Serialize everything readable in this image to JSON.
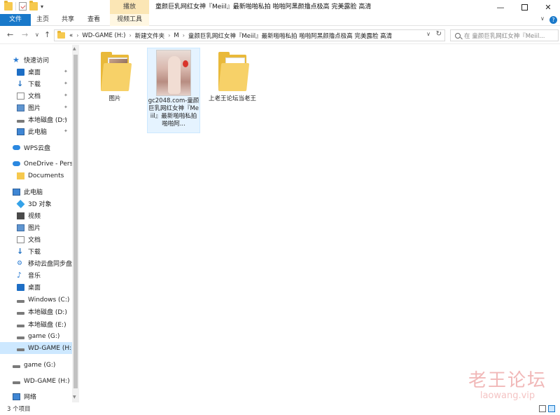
{
  "window": {
    "title": "童颜巨乳网红女神『Meiil』最新啪啪私拍 啪啪阿黑颜撸点极高 完美露脸 高清",
    "context_tab": "播放",
    "controls": {
      "minimize": "—",
      "close": "✕"
    }
  },
  "ribbon": {
    "tabs": [
      "文件",
      "主页",
      "共享",
      "查看",
      "视频工具"
    ],
    "help": "?",
    "toggle": "∨"
  },
  "address": {
    "overflow": "«",
    "breadcrumbs": [
      "WD-GAME (H:)",
      "新建文件夹",
      "M",
      "童颜巨乳网红女神『Meiil』最新啪啪私拍 啪啪阿黑颜撸点极高 完美露脸 高清"
    ],
    "separator": "›",
    "search_placeholder": "在 童颜巨乳网红女神『Meiil...",
    "nav": {
      "back": "←",
      "forward": "→",
      "recent": "∨",
      "up": "↑",
      "refresh": "↻",
      "dropdown": "∨"
    }
  },
  "sidebar": {
    "items": [
      {
        "label": "快速访问",
        "icon": "star-icon",
        "pinned": false
      },
      {
        "label": "桌面",
        "icon": "desktop-icon",
        "pinned": true
      },
      {
        "label": "下载",
        "icon": "download-icon",
        "pinned": true
      },
      {
        "label": "文档",
        "icon": "document-icon",
        "pinned": true
      },
      {
        "label": "图片",
        "icon": "pictures-icon",
        "pinned": true
      },
      {
        "label": "本地磁盘 (D:)",
        "icon": "drive-icon",
        "pinned": true
      },
      {
        "label": "此电脑",
        "icon": "computer-icon",
        "pinned": true
      },
      {
        "label": "WPS云盘",
        "icon": "cloud-icon",
        "pinned": false
      },
      {
        "label": "OneDrive - Perso",
        "icon": "onedrive-icon",
        "pinned": false
      },
      {
        "label": "Documents",
        "icon": "folder-icon",
        "pinned": false
      },
      {
        "label": "此电脑",
        "icon": "computer-icon",
        "pinned": false
      },
      {
        "label": "3D 对象",
        "icon": "3d-objects-icon",
        "pinned": false
      },
      {
        "label": "视频",
        "icon": "video-icon",
        "pinned": false
      },
      {
        "label": "图片",
        "icon": "pictures-icon",
        "pinned": false
      },
      {
        "label": "文档",
        "icon": "document-icon",
        "pinned": false
      },
      {
        "label": "下载",
        "icon": "download-icon",
        "pinned": false
      },
      {
        "label": "移动云盘同步盘",
        "icon": "sync-icon",
        "pinned": false
      },
      {
        "label": "音乐",
        "icon": "music-icon",
        "pinned": false
      },
      {
        "label": "桌面",
        "icon": "desktop-icon",
        "pinned": false
      },
      {
        "label": "Windows (C:)",
        "icon": "drive-icon",
        "pinned": false
      },
      {
        "label": "本地磁盘 (D:)",
        "icon": "drive-icon",
        "pinned": false
      },
      {
        "label": "本地磁盘 (E:)",
        "icon": "drive-icon",
        "pinned": false
      },
      {
        "label": "game (G:)",
        "icon": "drive-icon",
        "pinned": false
      },
      {
        "label": "WD-GAME (H:)",
        "icon": "drive-icon",
        "pinned": false,
        "selected": true
      },
      {
        "label": "game (G:)",
        "icon": "drive-icon",
        "pinned": false
      },
      {
        "label": "WD-GAME (H:)",
        "icon": "drive-icon",
        "pinned": false
      },
      {
        "label": "网络",
        "icon": "network-icon",
        "pinned": false
      }
    ]
  },
  "files": [
    {
      "name": "图片",
      "type": "folder"
    },
    {
      "name": "gc2048.com-童颜巨乳网红女神『Meiil』最新啪啪私拍 啪啪阿...",
      "type": "video",
      "selected": true
    },
    {
      "name": "上老王论坛当老王",
      "type": "folder"
    }
  ],
  "status": {
    "count": "3 个项目"
  },
  "watermark": {
    "title": "老王论坛",
    "url": "laowang.vip"
  },
  "colors": {
    "accent": "#1979ca",
    "selection": "#cde8ff",
    "context_tab": "#fbe6b5"
  }
}
